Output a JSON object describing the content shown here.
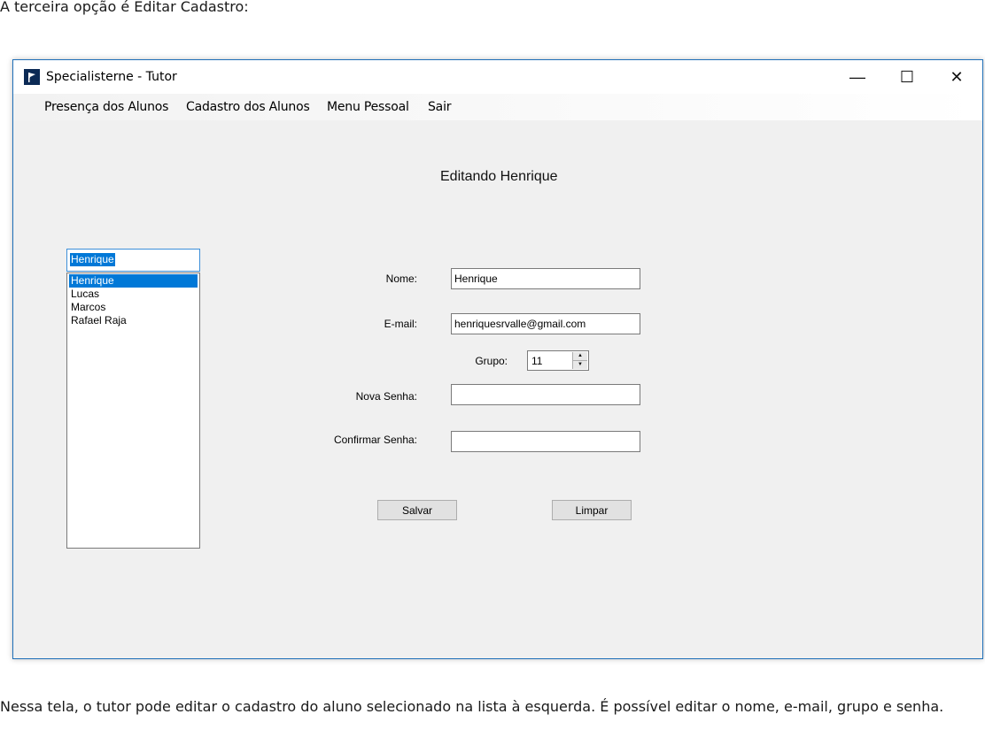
{
  "document": {
    "intro_text": "A terceira opção é Editar Cadastro:",
    "outro_text": "Nessa tela, o tutor pode editar o cadastro do aluno selecionado na lista à esquerda. É possível editar o nome, e-mail, grupo e senha."
  },
  "window": {
    "title": "Specialisterne - Tutor",
    "controls": {
      "minimize": "—",
      "maximize": "☐",
      "close": "✕"
    }
  },
  "menu": {
    "items": [
      "Presença dos Alunos",
      "Cadastro dos Alunos",
      "Menu Pessoal",
      "Sair"
    ]
  },
  "form": {
    "title": "Editando Henrique",
    "search_value": "Henrique",
    "students": [
      "Henrique",
      "Lucas",
      "Marcos",
      "Rafael Raja"
    ],
    "selected_student": "Henrique",
    "nome_label": "Nome:",
    "nome_value": "Henrique",
    "email_label": "E-mail:",
    "email_value": "henriquesrvalle@gmail.com",
    "grupo_label": "Grupo:",
    "grupo_value": "11",
    "nova_senha_label": "Nova Senha:",
    "nova_senha_value": "",
    "confirmar_senha_label": "Confirmar Senha:",
    "confirmar_senha_value": "",
    "salvar_label": "Salvar",
    "limpar_label": "Limpar"
  },
  "colors": {
    "accent": "#0078d7",
    "window_border": "#1f6fb8",
    "form_background": "#f0f0f0"
  },
  "icons": {
    "app": "flag-app-icon",
    "stepper_up": "triangle-up-icon",
    "stepper_down": "triangle-down-icon"
  }
}
